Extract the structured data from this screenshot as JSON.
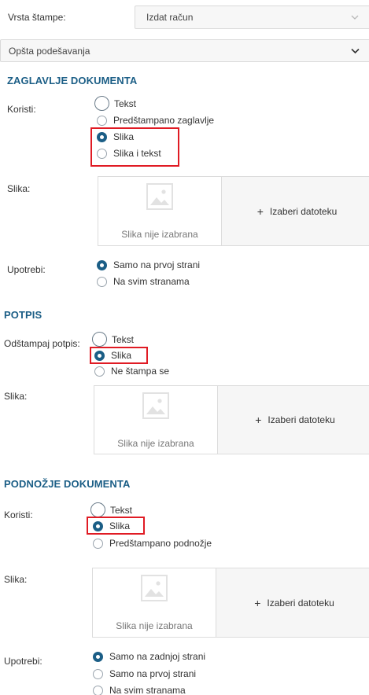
{
  "header": {
    "stamp_type_label": "Vrsta štampe:",
    "stamp_type_value": "Izdat račun",
    "settings_value": "Opšta podešavanja"
  },
  "doc_header": {
    "title": "ZAGLAVLJE DOKUMENTA",
    "use_label": "Koristi:",
    "options": [
      "Tekst",
      "Predštampano zaglavlje",
      "Slika",
      "Slika i tekst"
    ],
    "selected": "Slika",
    "image_label": "Slika:",
    "no_image": "Slika nije izabrana",
    "choose_file": "Izaberi datoteku",
    "apply_label": "Upotrebi:",
    "apply_options": [
      "Samo na prvoj strani",
      "Na svim stranama"
    ],
    "apply_selected": "Samo na prvoj strani"
  },
  "signature": {
    "title": "POTPIS",
    "print_label": "Odštampaj potpis:",
    "options": [
      "Tekst",
      "Slika",
      "Ne štampa se"
    ],
    "selected": "Slika",
    "image_label": "Slika:",
    "no_image": "Slika nije izabrana",
    "choose_file": "Izaberi datoteku"
  },
  "doc_footer": {
    "title": "PODNOŽJE DOKUMENTA",
    "use_label": "Koristi:",
    "options": [
      "Tekst",
      "Slika",
      "Predštampano podnožje"
    ],
    "selected": "Slika",
    "image_label": "Slika:",
    "no_image": "Slika nije izabrana",
    "choose_file": "Izaberi datoteku",
    "apply_label": "Upotrebi:",
    "apply_options": [
      "Samo na zadnjoj strani",
      "Samo na prvoj strani",
      "Na svim stranama"
    ],
    "apply_selected": "Samo na zadnjoj strani"
  },
  "colors": {
    "heading": "#1b5e86",
    "radio_selected": "#1b5e86",
    "highlight": "#e01b24"
  },
  "icons": [
    "chevron-down-icon",
    "image-placeholder-icon",
    "plus-icon"
  ]
}
